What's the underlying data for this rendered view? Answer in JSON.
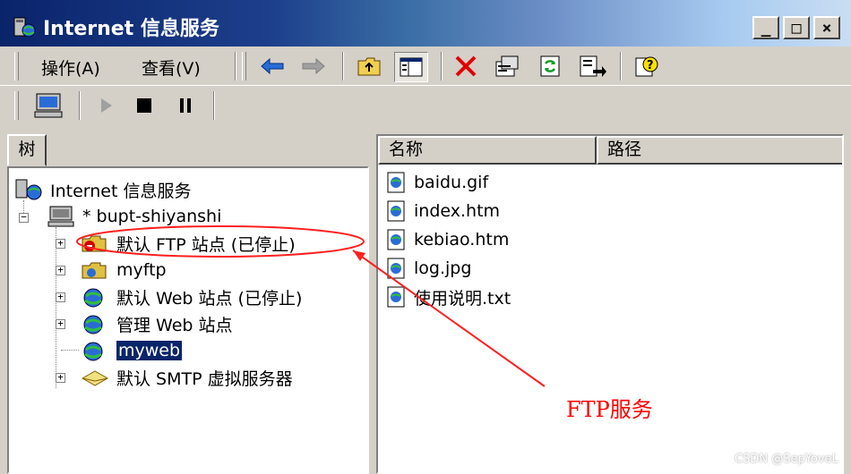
{
  "window": {
    "title": "Internet 信息服务",
    "controls": [
      "_",
      "□",
      "×"
    ]
  },
  "menu": {
    "action": "操作(A)",
    "view": "查看(V)"
  },
  "toolbar": {
    "icons": [
      "back-arrow-icon",
      "forward-arrow-icon",
      "up-folder-icon",
      "show-tree-icon",
      "delete-icon",
      "properties-icon",
      "refresh-icon",
      "export-list-icon",
      "help-icon"
    ]
  },
  "toolbar2": {
    "icons": [
      "computer-icon",
      "play-icon",
      "stop-icon",
      "pause-icon"
    ]
  },
  "left_pane": {
    "tab_label": "树",
    "tree": {
      "root": "Internet 信息服务",
      "server": "* bupt-shiyanshi",
      "children": [
        {
          "label": "默认 FTP 站点 (已停止)",
          "kind": "ftp-stopped"
        },
        {
          "label": "myftp",
          "kind": "ftp"
        },
        {
          "label": "默认 Web 站点 (已停止)",
          "kind": "web"
        },
        {
          "label": "管理 Web 站点",
          "kind": "web"
        },
        {
          "label": "myweb",
          "kind": "web-selected"
        },
        {
          "label": "默认 SMTP 虚拟服务器",
          "kind": "smtp"
        }
      ]
    }
  },
  "right_pane": {
    "columns": [
      "名称",
      "路径"
    ],
    "files": [
      "baidu.gif",
      "index.htm",
      "kebiao.htm",
      "log.jpg",
      "使用说明.txt"
    ]
  },
  "annotation": {
    "text": "FTP服务",
    "color": "#ff0000"
  },
  "watermark": "CSDN @SepYoveL"
}
